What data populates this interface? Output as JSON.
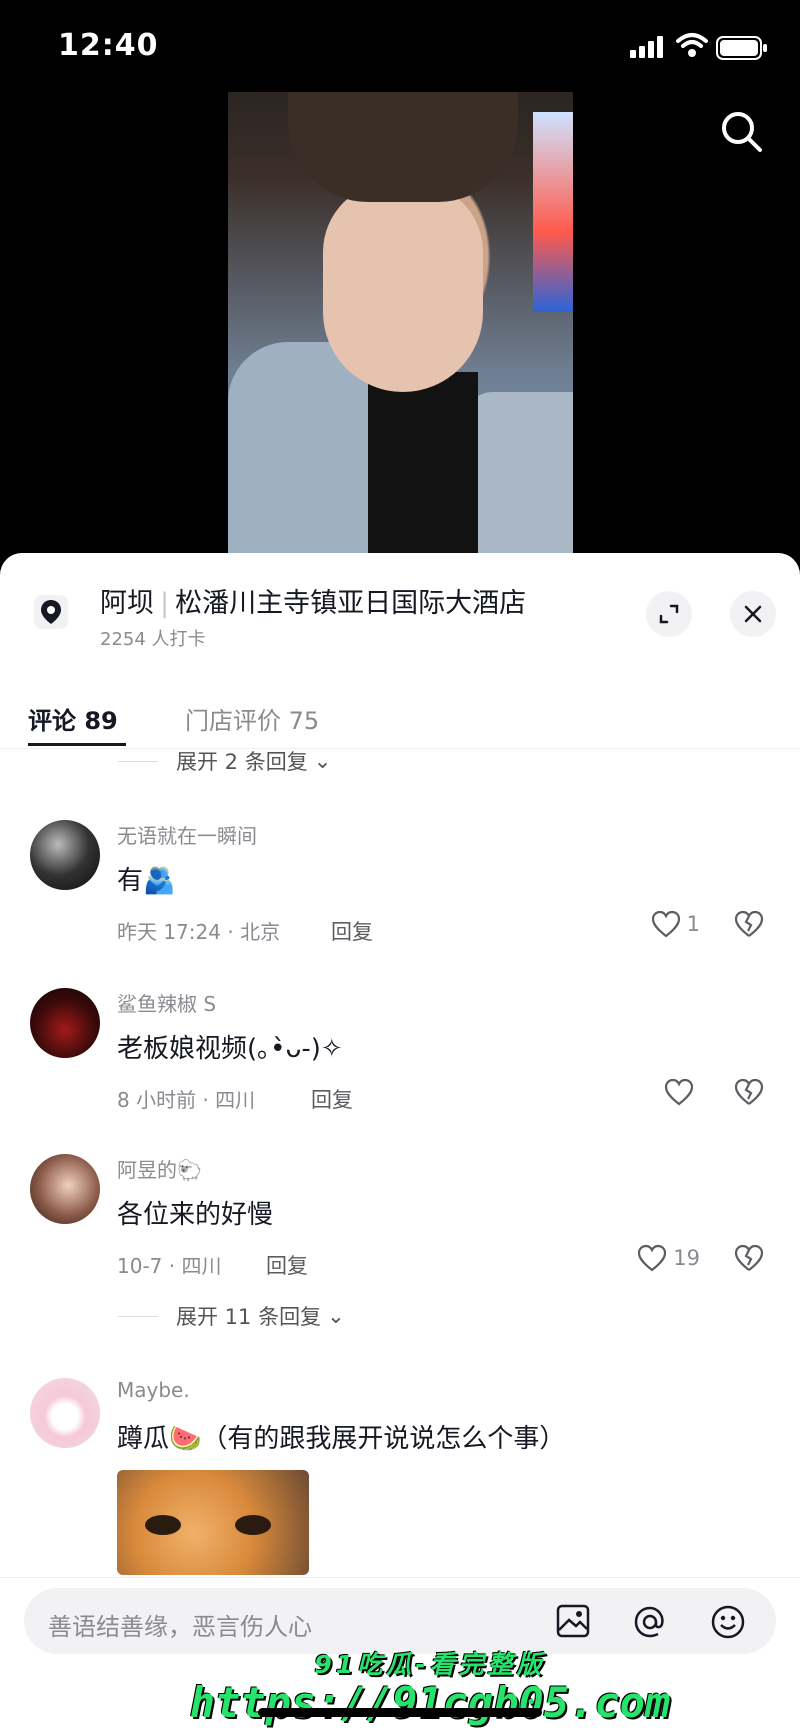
{
  "status_bar": {
    "time": "12:40"
  },
  "location": {
    "city": "阿坝",
    "name": "松潘川主寺镇亚日国际大酒店",
    "checkins": "2254 人打卡"
  },
  "tabs": [
    {
      "label": "评论 89",
      "active": true
    },
    {
      "label": "门店评价 75",
      "active": false
    }
  ],
  "expand_top": "展开 2 条回复",
  "comments": [
    {
      "username": "无语就在一瞬间",
      "text": "有🫂",
      "meta": "昨天 17:24 · 北京",
      "reply": "回复",
      "likes": "1"
    },
    {
      "username": "鲨鱼辣椒 S",
      "text": "老板娘视频(｡•̀ᴗ-)✧",
      "meta": "8 小时前 · 四川",
      "reply": "回复",
      "likes": ""
    },
    {
      "username": "阿昱的🐑",
      "text": "各位来的好慢",
      "meta": "10-7 · 四川",
      "reply": "回复",
      "likes": "19"
    },
    {
      "username": "Maybe.",
      "text": "蹲瓜🍉（有的跟我展开说说怎么个事）",
      "meta": "",
      "reply": "",
      "likes": ""
    }
  ],
  "expand_mid": "展开 11 条回复",
  "input": {
    "placeholder": "善语结善缘，恶言伤人心"
  },
  "watermark": {
    "line1": "91吃瓜-看完整版",
    "line2": "https://91cgb05.com"
  },
  "colors": {
    "accent": "#161823",
    "muted": "#8a8b91",
    "watermark": "#26e36b"
  }
}
